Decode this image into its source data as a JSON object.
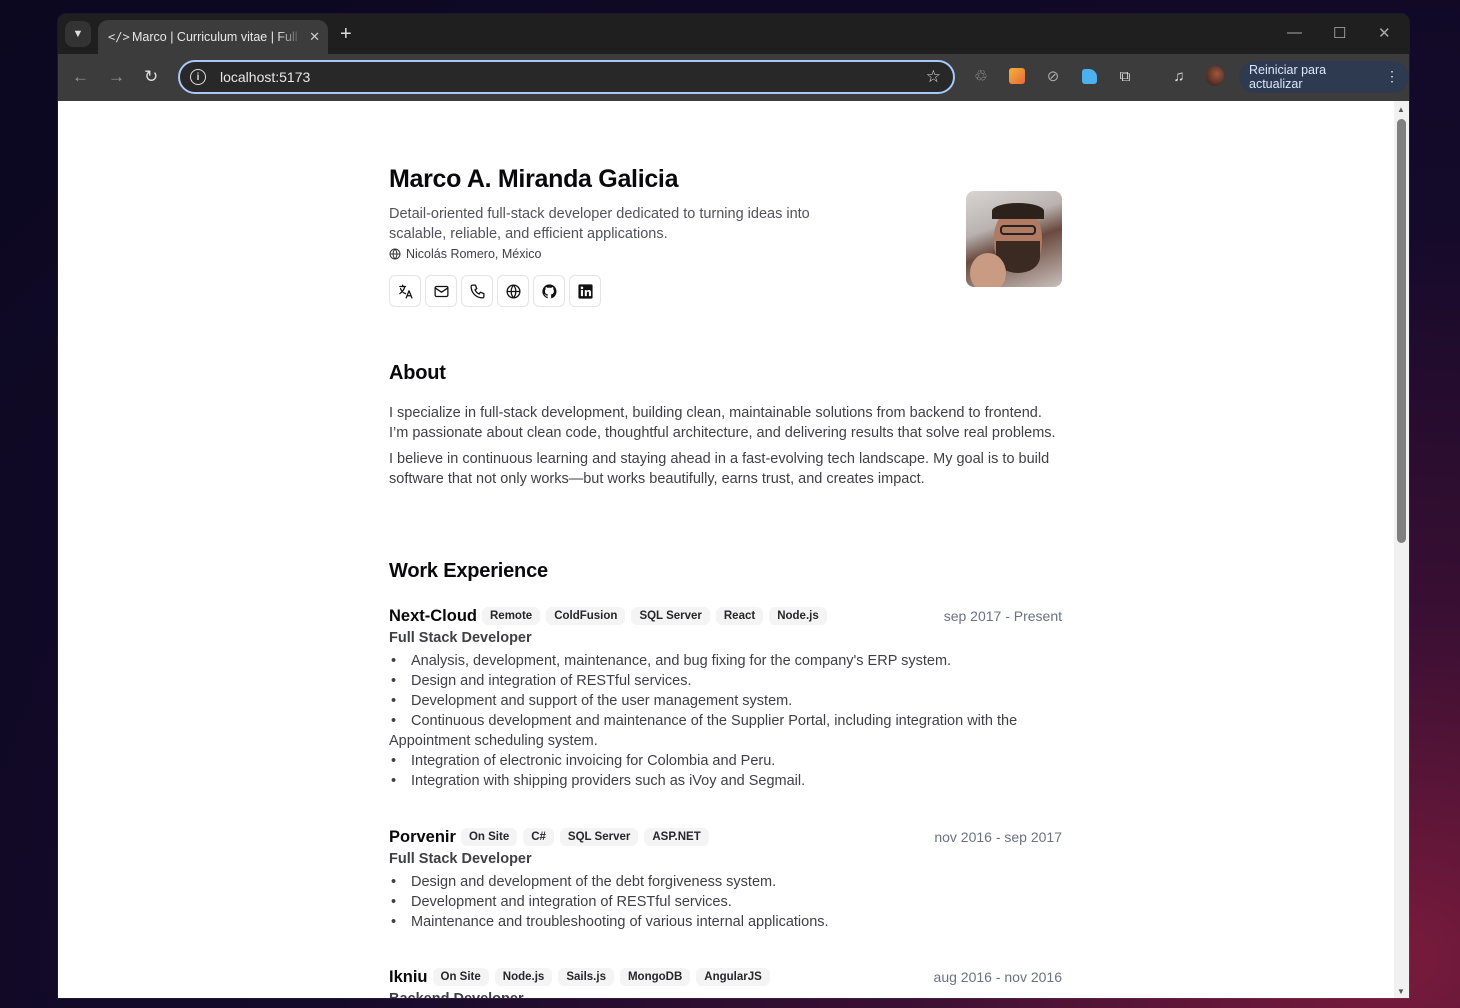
{
  "browser": {
    "tab_title": "Marco | Curriculum vitae | Full Stack Developer",
    "new_tab": "+",
    "url": "localhost:5173",
    "update_button": "Reiniciar para actualizar"
  },
  "profile": {
    "name": "Marco A. Miranda Galicia",
    "tagline": "Detail-oriented full-stack developer dedicated to turning ideas into scalable, reliable, and efficient applications.",
    "location": "Nicolás Romero, México",
    "links": [
      "translate-icon",
      "mail-icon",
      "phone-icon",
      "globe-icon",
      "github-icon",
      "linkedin-icon"
    ]
  },
  "about": {
    "title": "About",
    "paragraphs": [
      "I specialize in full-stack development, building clean, maintainable solutions from backend to frontend. I’m passionate about clean code, thoughtful architecture, and delivering results that solve real problems.",
      "I believe in continuous learning and staying ahead in a fast-evolving tech landscape. My goal is to build software that not only works—but works beautifully, earns trust, and creates impact."
    ]
  },
  "work": {
    "title": "Work Experience",
    "jobs": [
      {
        "company": "Next-Cloud",
        "badges": [
          "Remote",
          "ColdFusion",
          "SQL Server",
          "React",
          "Node.js"
        ],
        "dates": "sep 2017 - Present",
        "role": "Full Stack Developer",
        "bullets": [
          "Analysis, development, maintenance, and bug fixing for the company's ERP system.",
          "Design and integration of RESTful services.",
          "Development and support of the user management system.",
          "Continuous development and maintenance of the Supplier Portal, including integration with the Appointment scheduling system.",
          "Integration of electronic invoicing for Colombia and Peru.",
          "Integration with shipping providers such as iVoy and Segmail."
        ]
      },
      {
        "company": "Porvenir",
        "badges": [
          "On Site",
          "C#",
          "SQL Server",
          "ASP.NET"
        ],
        "dates": "nov 2016 - sep 2017",
        "role": "Full Stack Developer",
        "bullets": [
          "Design and development of the debt forgiveness system.",
          "Development and integration of RESTful services.",
          "Maintenance and troubleshooting of various internal applications."
        ]
      },
      {
        "company": "Ikniu",
        "badges": [
          "On Site",
          "Node.js",
          "Sails.js",
          "MongoDB",
          "AngularJS"
        ],
        "dates": "aug 2016 - nov 2016",
        "role": "Backend Developer",
        "bullets": []
      }
    ]
  }
}
